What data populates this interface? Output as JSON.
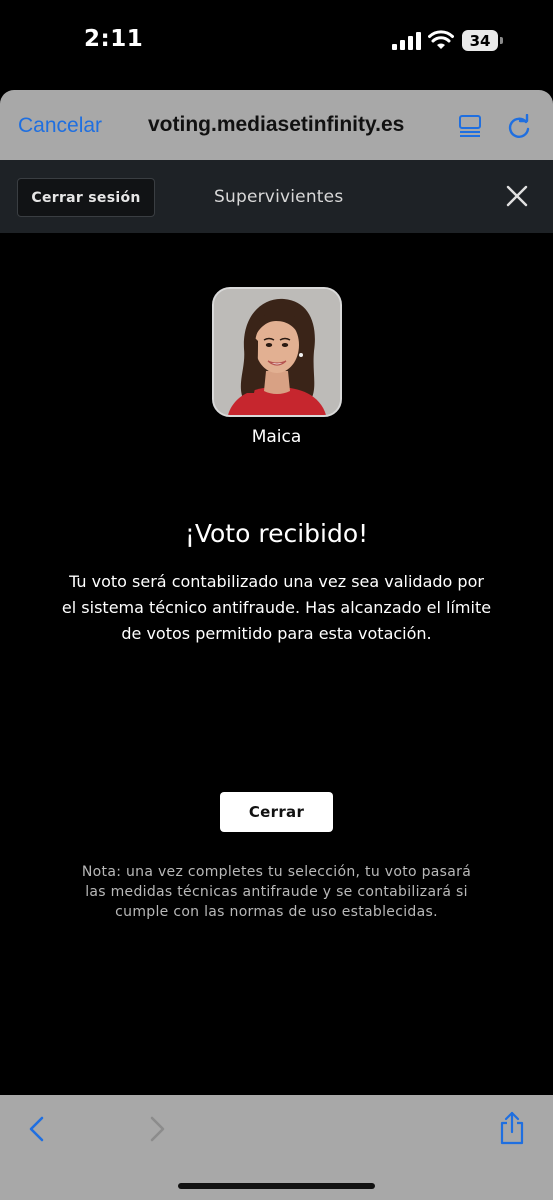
{
  "status_bar": {
    "time": "2:11",
    "battery": "34",
    "icons": [
      "signal-icon",
      "wifi-icon",
      "battery-icon"
    ]
  },
  "browser": {
    "cancel_label": "Cancelar",
    "url": "voting.mediasetinfinity.es",
    "icons": [
      "reader-icon",
      "reload-icon"
    ],
    "accent_color": "#1f6fe0"
  },
  "page_header": {
    "logout_label": "Cerrar sesión",
    "show_title": "Supervivientes",
    "close_icon": "close-icon"
  },
  "contestant": {
    "name": "Maica"
  },
  "confirmation": {
    "heading": "¡Voto recibido!",
    "message": "Tu voto será contabilizado una vez sea validado por el sistema técnico antifraude. Has alcanzado el límite de votos permitido para esta votación.",
    "close_label": "Cerrar"
  },
  "note": "Nota: una vez completes tu selección, tu voto pasará las medidas técnicas antifraude y se contabilizará si cumple con las normas de uso establecidas.",
  "toolbar": {
    "icons": [
      "back-icon",
      "forward-icon",
      "share-icon"
    ]
  }
}
